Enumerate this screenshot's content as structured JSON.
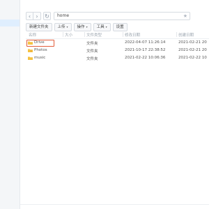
{
  "path": {
    "value": "home",
    "back_icon": "chevron-left-icon",
    "forward_icon": "chevron-right-icon",
    "refresh_icon": "refresh-icon",
    "favorite_icon": "star-icon"
  },
  "toolbar": {
    "new_folder": "新建文件夹",
    "upload": "上传",
    "action": "操作",
    "tools": "工具",
    "settings": "设置"
  },
  "columns": {
    "name": "名称",
    "size": "大小",
    "type": "文件类型",
    "modified": "修改日期",
    "created": "创建日期"
  },
  "files": [
    {
      "name": "Drive",
      "type": "文件夹",
      "modified": "2022-04-07 11:26:14",
      "created": "2021-02-21 20",
      "icon": "folder-icon",
      "highlighted": true
    },
    {
      "name": "Photos",
      "type": "文件夹",
      "modified": "2021-10-17 22:38:52",
      "created": "2021-02-21 20",
      "icon": "photo-folder-icon",
      "highlighted": false
    },
    {
      "name": "music",
      "type": "文件夹",
      "modified": "2021-02-22 10:06:36",
      "created": "2021-02-22 10",
      "icon": "folder-icon",
      "highlighted": false
    }
  ],
  "colors": {
    "highlight_border": "#e25c3a",
    "folder": "#f5c242",
    "sidebar_selected": "#dfeefe"
  }
}
